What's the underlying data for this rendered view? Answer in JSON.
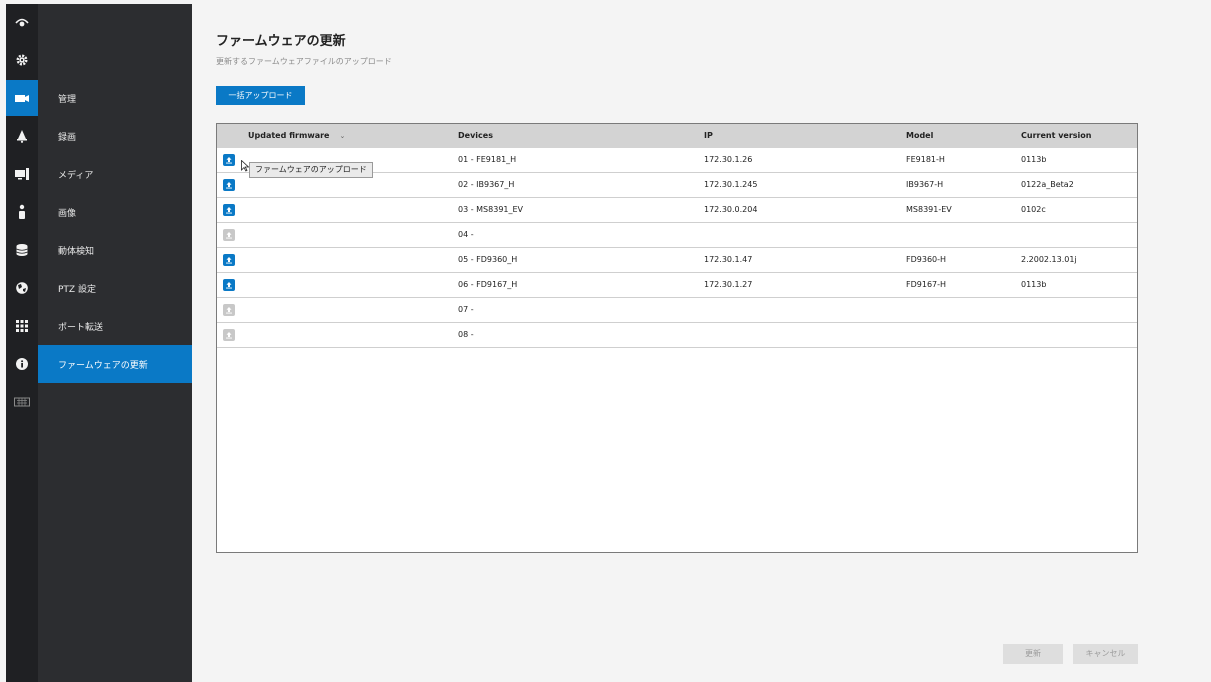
{
  "rail": {
    "items": [
      {
        "icon": "eye-icon",
        "active": false
      },
      {
        "icon": "gear-icon",
        "active": false
      },
      {
        "icon": "video-camera-icon",
        "active": true
      },
      {
        "icon": "bell-icon",
        "active": false
      },
      {
        "icon": "monitor-icon",
        "active": false
      },
      {
        "icon": "person-icon",
        "active": false
      },
      {
        "icon": "database-icon",
        "active": false
      },
      {
        "icon": "globe-icon",
        "active": false
      },
      {
        "icon": "grid-icon",
        "active": false
      },
      {
        "icon": "info-icon",
        "active": false
      },
      {
        "icon": "keyboard-icon",
        "active": false
      }
    ]
  },
  "nav": {
    "items": [
      {
        "label": "管理"
      },
      {
        "label": "録画"
      },
      {
        "label": "メディア"
      },
      {
        "label": "画像"
      },
      {
        "label": "動体検知"
      },
      {
        "label": "PTZ 設定"
      },
      {
        "label": "ポート転送"
      },
      {
        "label": "ファームウェアの更新"
      }
    ],
    "active_index": 7
  },
  "page": {
    "title": "ファームウェアの更新",
    "subtitle": "更新するファームウェアファイルのアップロード",
    "bulk_upload_label": "一括アップロード"
  },
  "table": {
    "headers": {
      "updated_firmware": "Updated firmware",
      "devices": "Devices",
      "ip": "IP",
      "model": "Model",
      "current_version": "Current version"
    },
    "rows": [
      {
        "device": "01 - FE9181_H",
        "ip": "172.30.1.26",
        "model": "FE9181-H",
        "version": "0113b",
        "upload_enabled": true
      },
      {
        "device": "02 - IB9367_H",
        "ip": "172.30.1.245",
        "model": "IB9367-H",
        "version": "0122a_Beta2",
        "upload_enabled": true
      },
      {
        "device": "03 - MS8391_EV",
        "ip": "172.30.0.204",
        "model": "MS8391-EV",
        "version": "0102c",
        "upload_enabled": true
      },
      {
        "device": "04 -",
        "ip": "",
        "model": "",
        "version": "",
        "upload_enabled": false
      },
      {
        "device": "05 - FD9360_H",
        "ip": "172.30.1.47",
        "model": "FD9360-H",
        "version": "2.2002.13.01j",
        "upload_enabled": true
      },
      {
        "device": "06 - FD9167_H",
        "ip": "172.30.1.27",
        "model": "FD9167-H",
        "version": "0113b",
        "upload_enabled": true
      },
      {
        "device": "07 -",
        "ip": "",
        "model": "",
        "version": "",
        "upload_enabled": false
      },
      {
        "device": "08 -",
        "ip": "",
        "model": "",
        "version": "",
        "upload_enabled": false
      }
    ],
    "tooltip": "ファームウェアのアップロード"
  },
  "footer": {
    "update_label": "更新",
    "cancel_label": "キャンセル"
  },
  "colors": {
    "accent": "#0a79c6",
    "rail_bg": "#1f2023",
    "nav_bg": "#2c2d30",
    "disabled_icon": "#c8c8c8"
  }
}
